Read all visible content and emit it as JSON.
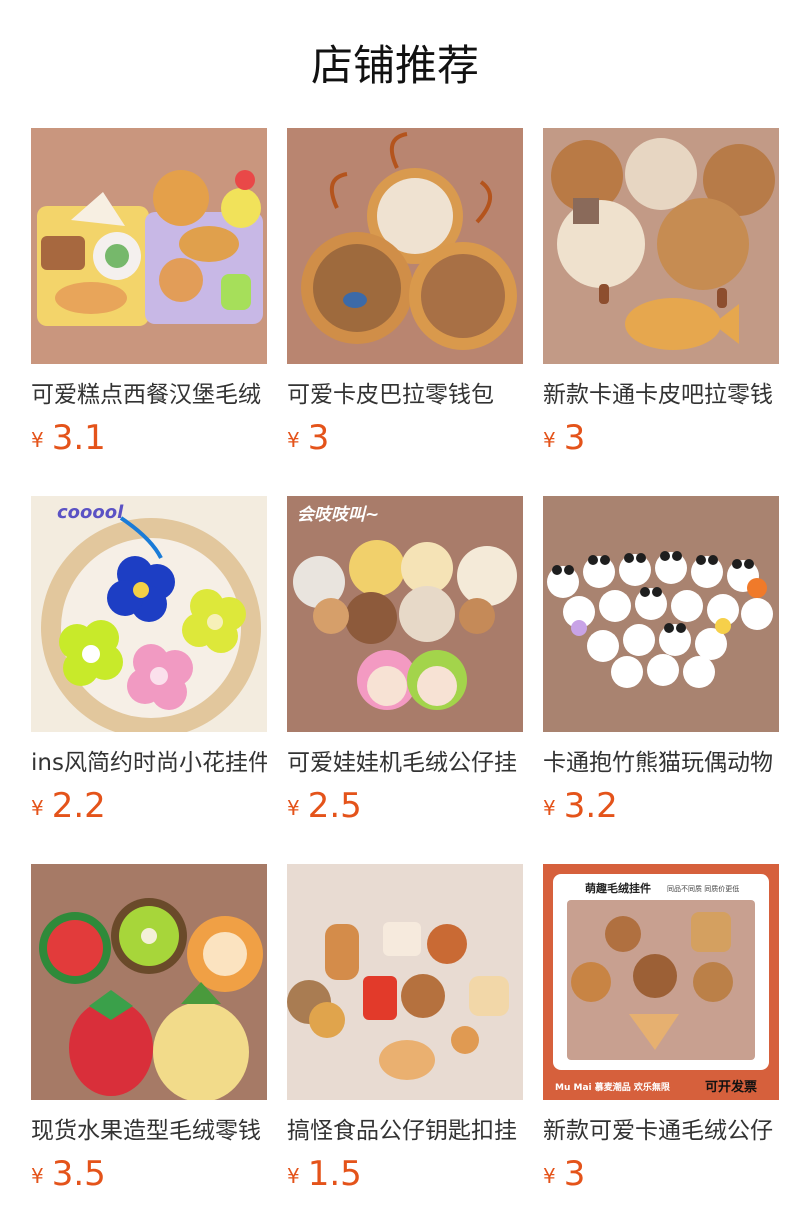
{
  "header": {
    "title": "店铺推荐"
  },
  "currency_symbol": "¥",
  "products": [
    {
      "title": "可爱糕点西餐汉堡毛绒",
      "price": "3.1",
      "image": "pastry-plush-image",
      "bg": "#c9967e"
    },
    {
      "title": "可爱卡皮巴拉零钱包",
      "price": "3",
      "image": "capybara-purse-image",
      "bg": "#b98570"
    },
    {
      "title": "新款卡通卡皮吧拉零钱",
      "price": "3",
      "image": "capybara-cookie-image",
      "bg": "#c29a86"
    },
    {
      "title": "ins风简约时尚小花挂件",
      "price": "2.2",
      "image": "flower-charm-image",
      "bg": "#f3ecdf",
      "overlay": "cooool"
    },
    {
      "title": "可爱娃娃机毛绒公仔挂",
      "price": "2.5",
      "image": "claw-machine-plush-image",
      "bg": "#a97c6a",
      "overlay": "会吱吱叫~"
    },
    {
      "title": "卡通抱竹熊猫玩偶动物",
      "price": "3.2",
      "image": "panda-plush-image",
      "bg": "#a98370"
    },
    {
      "title": "现货水果造型毛绒零钱",
      "price": "3.5",
      "image": "fruit-purse-image",
      "bg": "#a67a66"
    },
    {
      "title": "搞怪食品公仔钥匙扣挂",
      "price": "1.5",
      "image": "food-keychain-image",
      "bg": "#e8dbd2"
    },
    {
      "title": "新款可爱卡通毛绒公仔",
      "price": "3",
      "image": "plush-pendant-poster-image",
      "bg": "#d6603c",
      "poster": {
        "heading": "萌趣毛绒挂件",
        "tagline": "同品不同质 同质价更低",
        "footer": "Mu Mai 慕麦潮品 欢乐無限",
        "badge": "可开发票"
      }
    }
  ]
}
